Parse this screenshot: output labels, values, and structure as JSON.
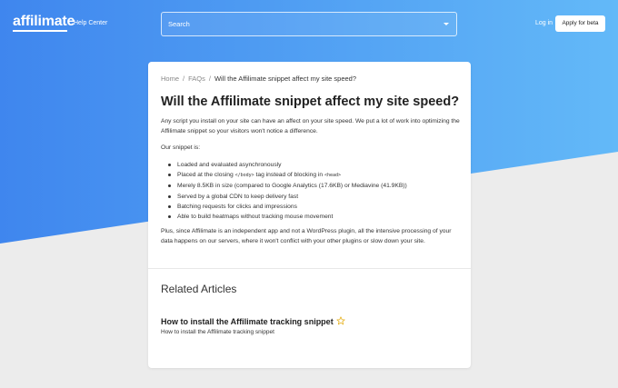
{
  "header": {
    "logo": "affilimate",
    "help_center": "Help Center",
    "search_placeholder": "Search",
    "login": "Log in",
    "apply": "Apply for beta"
  },
  "breadcrumb": {
    "home": "Home",
    "faqs": "FAQs",
    "current": "Will the Affilimate snippet affect my site speed?"
  },
  "article": {
    "title": "Will the Affilimate snippet affect my site speed?",
    "intro": "Any script you install on your site can have an affect on your site speed. We put a lot of work into optimizing the Affilimate snippet so your visitors won't notice a difference.",
    "snippet_is": "Our snippet is:",
    "bullets": {
      "b1": "Loaded and evaluated asynchronously",
      "b2_pre": "Placed at the closing ",
      "b2_code1": "</body>",
      "b2_mid": " tag instead of blocking in ",
      "b2_code2": "<head>",
      "b3": "Merely 8.5KB in size (compared to Google Analytics (17.6KB) or Mediavine (41.9KB))",
      "b4": "Served by a global CDN to keep delivery fast",
      "b5": "Batching requests for clicks and impressions",
      "b6": "Able to build heatmaps without tracking mouse movement"
    },
    "closing": "Plus, since Affilimate is an independent app and not a WordPress plugin, all the intensive processing of your data happens on our servers, where it won't conflict with your other plugins or slow down your site."
  },
  "related": {
    "heading": "Related Articles",
    "link": "How to install the Affilimate tracking snippet",
    "desc": "How to install the Affilimate tracking snippet"
  },
  "colors": {
    "gradient_start": "#3f86ee",
    "gradient_end": "#63b9f8",
    "background": "#ececec",
    "star": "#e7b323"
  }
}
